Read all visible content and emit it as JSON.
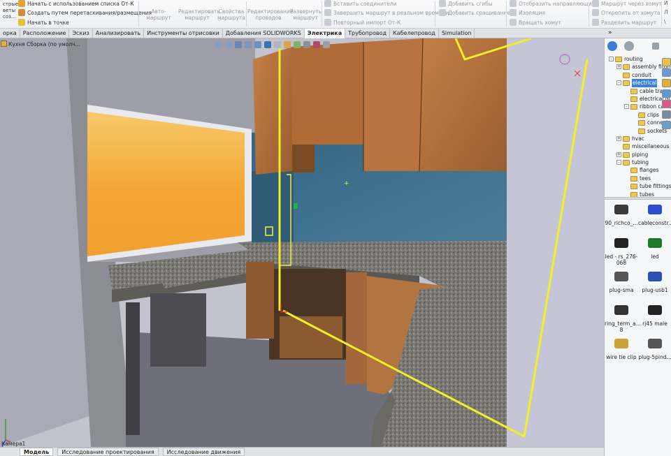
{
  "ribbon": {
    "left_group": [
      {
        "label": "Начать с использованием списка От-К",
        "icon": "list-icon"
      },
      {
        "label": "Создать путем перетаскивания/размещения",
        "icon": "drag-icon"
      },
      {
        "label": "Начать в точке",
        "icon": "point-icon"
      }
    ],
    "far_left_text": [
      "стрые",
      "веты",
      "соз..."
    ],
    "big_buttons": [
      {
        "label": "Авто-маршрут",
        "icon": "auto-route-icon"
      },
      {
        "label": "Редактировать маршрут",
        "icon": "edit-route-icon"
      },
      {
        "label": "Свойства маршрута",
        "icon": "route-properties-icon"
      },
      {
        "label": "Редактирование проводов",
        "icon": "edit-wires-icon"
      },
      {
        "label": "Развернуть маршрут",
        "icon": "flatten-route-icon"
      }
    ],
    "mid_group": [
      {
        "label": "Вставить соединители",
        "icon": "connector-icon"
      },
      {
        "label": "Завершить маршрут в реальном времени",
        "icon": "finish-route-icon"
      },
      {
        "label": "Повторный импорт От-К",
        "icon": "reimport-icon"
      }
    ],
    "right_group": [
      {
        "label": "Добавить сгибы",
        "icon": "bend-icon"
      },
      {
        "label": "Добавить сращивание",
        "icon": "splice-icon"
      }
    ],
    "far_right_group": [
      {
        "label": "Отобразить направляющие",
        "icon": "guides-icon"
      },
      {
        "label": "Изоляция",
        "icon": "insulation-icon"
      },
      {
        "label": "Вращать хомут",
        "icon": "rotate-clip-icon"
      }
    ],
    "edge_group": [
      {
        "label": "Маршрут через хомут",
        "icon": "route-through-clip-icon"
      },
      {
        "label": "Открепить от хомута",
        "icon": "detach-clip-icon"
      },
      {
        "label": "Разделить маршрут",
        "icon": "split-route-icon"
      }
    ],
    "edge_truncated": [
      "И",
      "Л",
      "\\"
    ]
  },
  "tabs": [
    "орка",
    "Расположение",
    "Эскиз",
    "Анализировать",
    "Инструменты отрисовки",
    "Добавления SOLIDWORKS",
    "Электрика",
    "Трубопровод",
    "Кабелепровод",
    "Simulation"
  ],
  "active_tab": "Электрика",
  "viewport": {
    "doc_title": "Кухня Сборка  (по умолч...",
    "camera_label": "Камера1"
  },
  "right_panel": {
    "expand_symbol": "»",
    "tree": [
      {
        "label": "routing",
        "level": 0,
        "expander": "-"
      },
      {
        "label": "assembly fittings",
        "level": 1,
        "expander": "+"
      },
      {
        "label": "conduit",
        "level": 1,
        "expander": ""
      },
      {
        "label": "electrical",
        "level": 1,
        "expander": "-",
        "selected": true
      },
      {
        "label": "cable tray",
        "level": 2,
        "expander": ""
      },
      {
        "label": "electrical duct",
        "level": 2,
        "expander": ""
      },
      {
        "label": "ribbon cable",
        "level": 2,
        "expander": "-"
      },
      {
        "label": "clips",
        "level": 3,
        "expander": ""
      },
      {
        "label": "connectors",
        "level": 3,
        "expander": ""
      },
      {
        "label": "sockets",
        "level": 3,
        "expander": ""
      },
      {
        "label": "hvac",
        "level": 1,
        "expander": "+"
      },
      {
        "label": "miscellaneous fittings",
        "level": 1,
        "expander": ""
      },
      {
        "label": "piping",
        "level": 1,
        "expander": "+"
      },
      {
        "label": "tubing",
        "level": 1,
        "expander": "-"
      },
      {
        "label": "flanges",
        "level": 2,
        "expander": ""
      },
      {
        "label": "tees",
        "level": 2,
        "expander": ""
      },
      {
        "label": "tube fittings",
        "level": 2,
        "expander": ""
      },
      {
        "label": "tubes",
        "level": 2,
        "expander": ""
      }
    ],
    "library": [
      {
        "label": "90_richco_...",
        "icon": "richco-clip-icon",
        "color": "#3a3a3a"
      },
      {
        "label": "cableconstr...",
        "icon": "cable-constraint-icon",
        "color": "#2a4fd0"
      },
      {
        "label": "led - rs_276-068",
        "icon": "led-icon",
        "color": "#222"
      },
      {
        "label": "led",
        "icon": "led-green-icon",
        "color": "#1f7a2a"
      },
      {
        "label": "plug-sma",
        "icon": "plug-sma-icon",
        "color": "#555"
      },
      {
        "label": "plug-usb1",
        "icon": "plug-usb-icon",
        "color": "#2b50b8"
      },
      {
        "label": "ring_term_a... 8",
        "icon": "ring-terminal-icon",
        "color": "#333"
      },
      {
        "label": "rj45 male",
        "icon": "rj45-icon",
        "color": "#222"
      },
      {
        "label": "wire tie clip",
        "icon": "wire-tie-icon",
        "color": "#c9a23a"
      },
      {
        "label": "plug-5pind...",
        "icon": "plug-5pin-icon",
        "color": "#555"
      }
    ]
  },
  "bottom_tabs": [
    "Модель",
    "Исследование проектирования",
    "Исследование движения"
  ],
  "active_bottom_tab": "Модель",
  "colors": {
    "route_highlight": "#f2ee2a",
    "backsplash": "#3d6f8c",
    "cabinet_wood": "#b3703c",
    "granite": "#7a7a76",
    "window_glow": "#f6a42c"
  }
}
